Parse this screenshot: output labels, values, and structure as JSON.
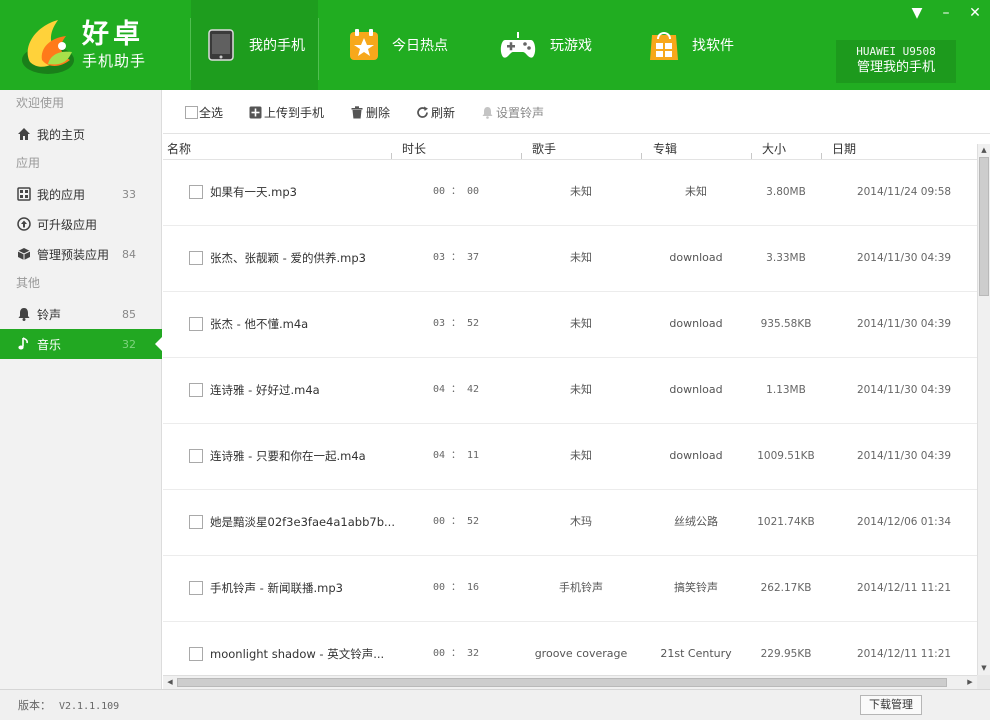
{
  "app": {
    "name": "好卓",
    "subtitle": "手机助手"
  },
  "nav": [
    {
      "label": "我的手机",
      "icon": "phone-icon",
      "active": true
    },
    {
      "label": "今日热点",
      "icon": "hot-star-icon",
      "active": false
    },
    {
      "label": "玩游戏",
      "icon": "gamepad-icon",
      "active": false
    },
    {
      "label": "找软件",
      "icon": "app-store-icon",
      "active": false
    }
  ],
  "device": {
    "model": "HUAWEI U9508",
    "manage_label": "管理我的手机"
  },
  "window_controls": {
    "menu": "▼",
    "minimize": "–",
    "close": "✕"
  },
  "sidebar": {
    "sections": [
      "欢迎使用",
      "应用",
      "其他"
    ],
    "items": [
      {
        "label": "我的主页",
        "count": "",
        "icon": "home-icon"
      },
      {
        "label": "我的应用",
        "count": "33",
        "icon": "apps-icon"
      },
      {
        "label": "可升级应用",
        "count": "",
        "icon": "upgrade-icon"
      },
      {
        "label": "管理预装应用",
        "count": "84",
        "icon": "preinstalled-box-icon"
      },
      {
        "label": "铃声",
        "count": "85",
        "icon": "bell-icon"
      },
      {
        "label": "音乐",
        "count": "32",
        "icon": "music-note-icon",
        "active": true
      }
    ]
  },
  "toolbar": {
    "select_all": "全选",
    "upload": "上传到手机",
    "delete": "删除",
    "refresh": "刷新",
    "set_ringtone": "设置铃声"
  },
  "table": {
    "columns": [
      "名称",
      "时长",
      "歌手",
      "专辑",
      "大小",
      "日期"
    ],
    "rows": [
      {
        "name": "如果有一天.mp3",
        "duration": "00 ： 00",
        "artist": "未知",
        "album": "未知",
        "size": "3.80MB",
        "date": "2014/11/24 09:58"
      },
      {
        "name": "张杰、张靓颖 - 爱的供养.mp3",
        "duration": "03 ： 37",
        "artist": "未知",
        "album": "download",
        "size": "3.33MB",
        "date": "2014/11/30 04:39"
      },
      {
        "name": "张杰 - 他不懂.m4a",
        "duration": "03 ： 52",
        "artist": "未知",
        "album": "download",
        "size": "935.58KB",
        "date": "2014/11/30 04:39"
      },
      {
        "name": "连诗雅 - 好好过.m4a",
        "duration": "04 ： 42",
        "artist": "未知",
        "album": "download",
        "size": "1.13MB",
        "date": "2014/11/30 04:39"
      },
      {
        "name": "连诗雅 - 只要和你在一起.m4a",
        "duration": "04 ： 11",
        "artist": "未知",
        "album": "download",
        "size": "1009.51KB",
        "date": "2014/11/30 04:39"
      },
      {
        "name": "她是黯淡星02f3e3fae4a1abb7b...",
        "duration": "00 ： 52",
        "artist": "木玛",
        "album": "丝绒公路",
        "size": "1021.74KB",
        "date": "2014/12/06 01:34"
      },
      {
        "name": "手机铃声 - 新闻联播.mp3",
        "duration": "00 ： 16",
        "artist": "手机铃声",
        "album": "搞笑铃声",
        "size": "262.17KB",
        "date": "2014/12/11 11:21"
      },
      {
        "name": "moonlight shadow - 英文铃声...",
        "duration": "00 ： 32",
        "artist": "groove coverage",
        "album": "21st Century",
        "size": "229.95KB",
        "date": "2014/12/11 11:21"
      }
    ]
  },
  "status": {
    "version_label": "版本：",
    "version": "V2.1.1.109",
    "download_manager": "下载管理"
  },
  "colors": {
    "brand_green": "#21ad21",
    "active_green": "#22a822"
  }
}
